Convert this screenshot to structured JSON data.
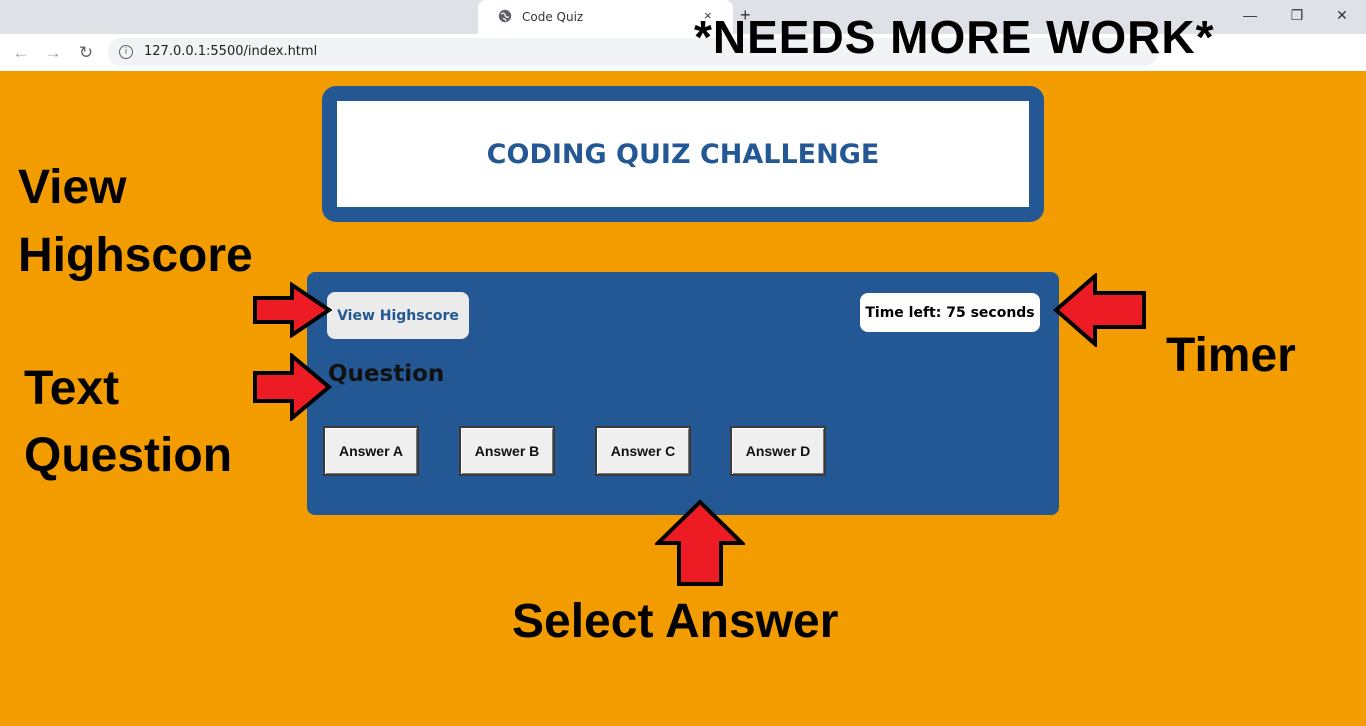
{
  "browser": {
    "tab_title": "Code Quiz",
    "tab_close": "×",
    "new_tab": "+",
    "url": "127.0.0.1:5500/index.html",
    "back": "←",
    "forward": "→",
    "reload": "↻",
    "info": "i",
    "minimize": "—",
    "restore": "❐",
    "close": "✕"
  },
  "banner": "*NEEDS MORE WORK*",
  "header": {
    "title": "CODING QUIZ CHALLENGE"
  },
  "quiz": {
    "highscore_button": "View Highscore",
    "timer": "Time left: 75 seconds",
    "question": "Question",
    "answers": [
      "Answer A",
      "Answer B",
      "Answer C",
      "Answer D"
    ]
  },
  "annotations": {
    "view_line1": "View",
    "view_line2": "Highscore",
    "text_line1": "Text",
    "text_line2": "Question",
    "timer": "Timer",
    "select": "Select Answer"
  },
  "colors": {
    "page_bg": "#f29c00",
    "accent": "#235894",
    "arrow": "#ed1c24"
  }
}
